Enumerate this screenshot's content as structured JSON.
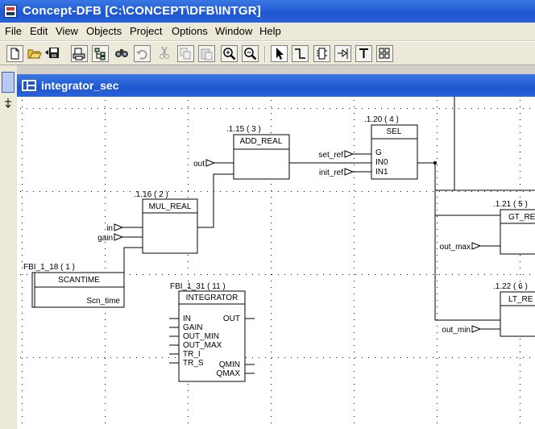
{
  "window": {
    "title": "Concept-DFB [C:\\CONCEPT\\DFB\\INTGR]"
  },
  "menu": [
    "File",
    "Edit",
    "View",
    "Objects",
    "Project",
    "Options",
    "Window",
    "Help"
  ],
  "toolbar": [
    {
      "name": "new-icon"
    },
    {
      "name": "open-folder-icon"
    },
    {
      "name": "save-icon"
    },
    {
      "name": "print-setup-icon"
    },
    {
      "name": "hierarchy-icon"
    },
    {
      "name": "find-icon"
    },
    {
      "name": "undo-icon",
      "disabled": true
    },
    {
      "name": "cut-icon",
      "disabled": true
    },
    {
      "name": "copy-icon",
      "disabled": true
    },
    {
      "name": "paste-icon",
      "disabled": true
    },
    {
      "name": "zoom-in-icon"
    },
    {
      "name": "zoom-out-icon"
    },
    {
      "name": "select-arrow-icon",
      "active": true
    },
    {
      "name": "link-icon"
    },
    {
      "name": "ffb-icon"
    },
    {
      "name": "io-pin-icon"
    },
    {
      "name": "text-tool-icon"
    },
    {
      "name": "palette-icon"
    }
  ],
  "document": {
    "title": "integrator_sec"
  },
  "blocks": {
    "add_real": {
      "ref": ".1.15 ( 3 )",
      "type": "ADD_REAL"
    },
    "sel": {
      "ref": ".1.20 ( 4 )",
      "type": "SEL",
      "inputs": [
        "G",
        "IN0",
        "IN1"
      ]
    },
    "mul_real": {
      "ref": ".1.16 ( 2 )",
      "type": "MUL_REAL"
    },
    "gt_real": {
      "ref": ".1.21 ( 5 )",
      "type": "GT_RE"
    },
    "lt_real": {
      "ref": ".1.22 ( 6 )",
      "type": "LT_RE"
    },
    "scantime": {
      "ref": "FBI_1_18 ( 1 )",
      "type": "SCANTIME",
      "output": "Scn_time"
    },
    "integrator": {
      "ref": "FBI_1_31 ( 11 )",
      "type": "INTEGRATOR",
      "inputs": [
        "IN",
        "GAIN",
        "OUT_MIN",
        "OUT_MAX",
        "TR_I",
        "TR_S"
      ],
      "outputs": [
        "OUT",
        "QMIN",
        "QMAX"
      ]
    }
  },
  "pins": {
    "out": "out",
    "in": "in",
    "gain": "gain",
    "set_ref": "set_ref",
    "init_ref": "init_ref",
    "out_max": "out_max",
    "out_min": "out_min"
  }
}
